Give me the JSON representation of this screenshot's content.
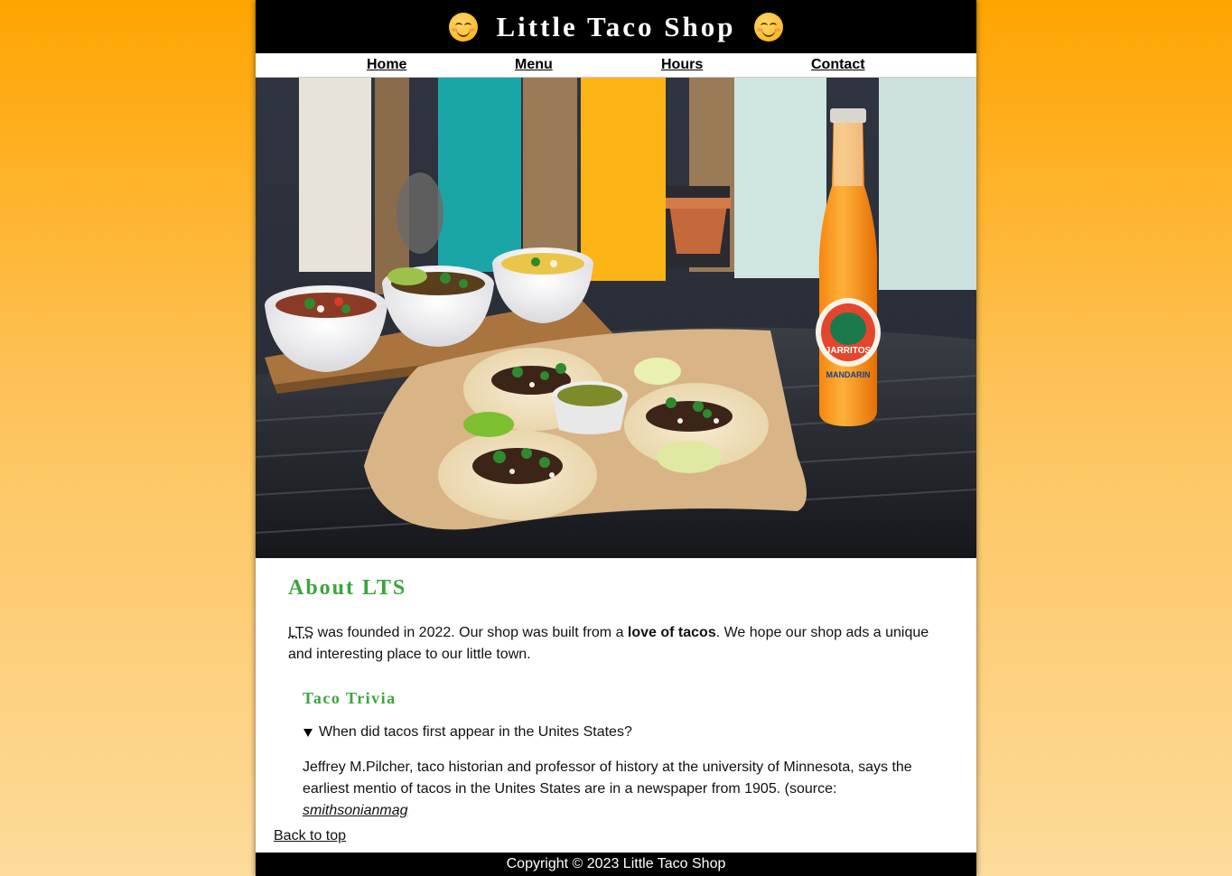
{
  "header": {
    "title": "Little Taco Shop",
    "emoji_left": "smiling-face-icon",
    "emoji_right": "smiling-face-icon"
  },
  "nav": {
    "items": [
      {
        "label": "Home"
      },
      {
        "label": "Menu"
      },
      {
        "label": "Hours"
      },
      {
        "label": "Contact"
      }
    ]
  },
  "hero": {
    "bottle_brand": "JARRITOS",
    "bottle_flavor": "MANDARIN"
  },
  "about": {
    "heading": "About LTS",
    "abbr": "LTS",
    "text_1": " was founded in 2022. Our shop was built from a ",
    "bold": "love of tacos",
    "text_2": ". We hope our shop ads a unique and interesting place to our little town."
  },
  "trivia": {
    "heading": "Taco Trivia",
    "question": "When did tacos first appear in the Unites States?",
    "answer": "Jeffrey M.Pilcher, taco historian and professor of history at the university of Minnesota, says the earliest mentio of tacos in the Unites States are in a newspaper from 1905. (source: ",
    "source_link": "smithsonianmag"
  },
  "back_to_top": "Back to top",
  "footer": {
    "copyright": "Copyright © 2023 Little Taco Shop"
  },
  "colors": {
    "accent_green": "#3aa53a",
    "header_bg": "#000000",
    "page_bg_top": "#ffa500",
    "page_bg_bottom": "#fddb9a"
  }
}
